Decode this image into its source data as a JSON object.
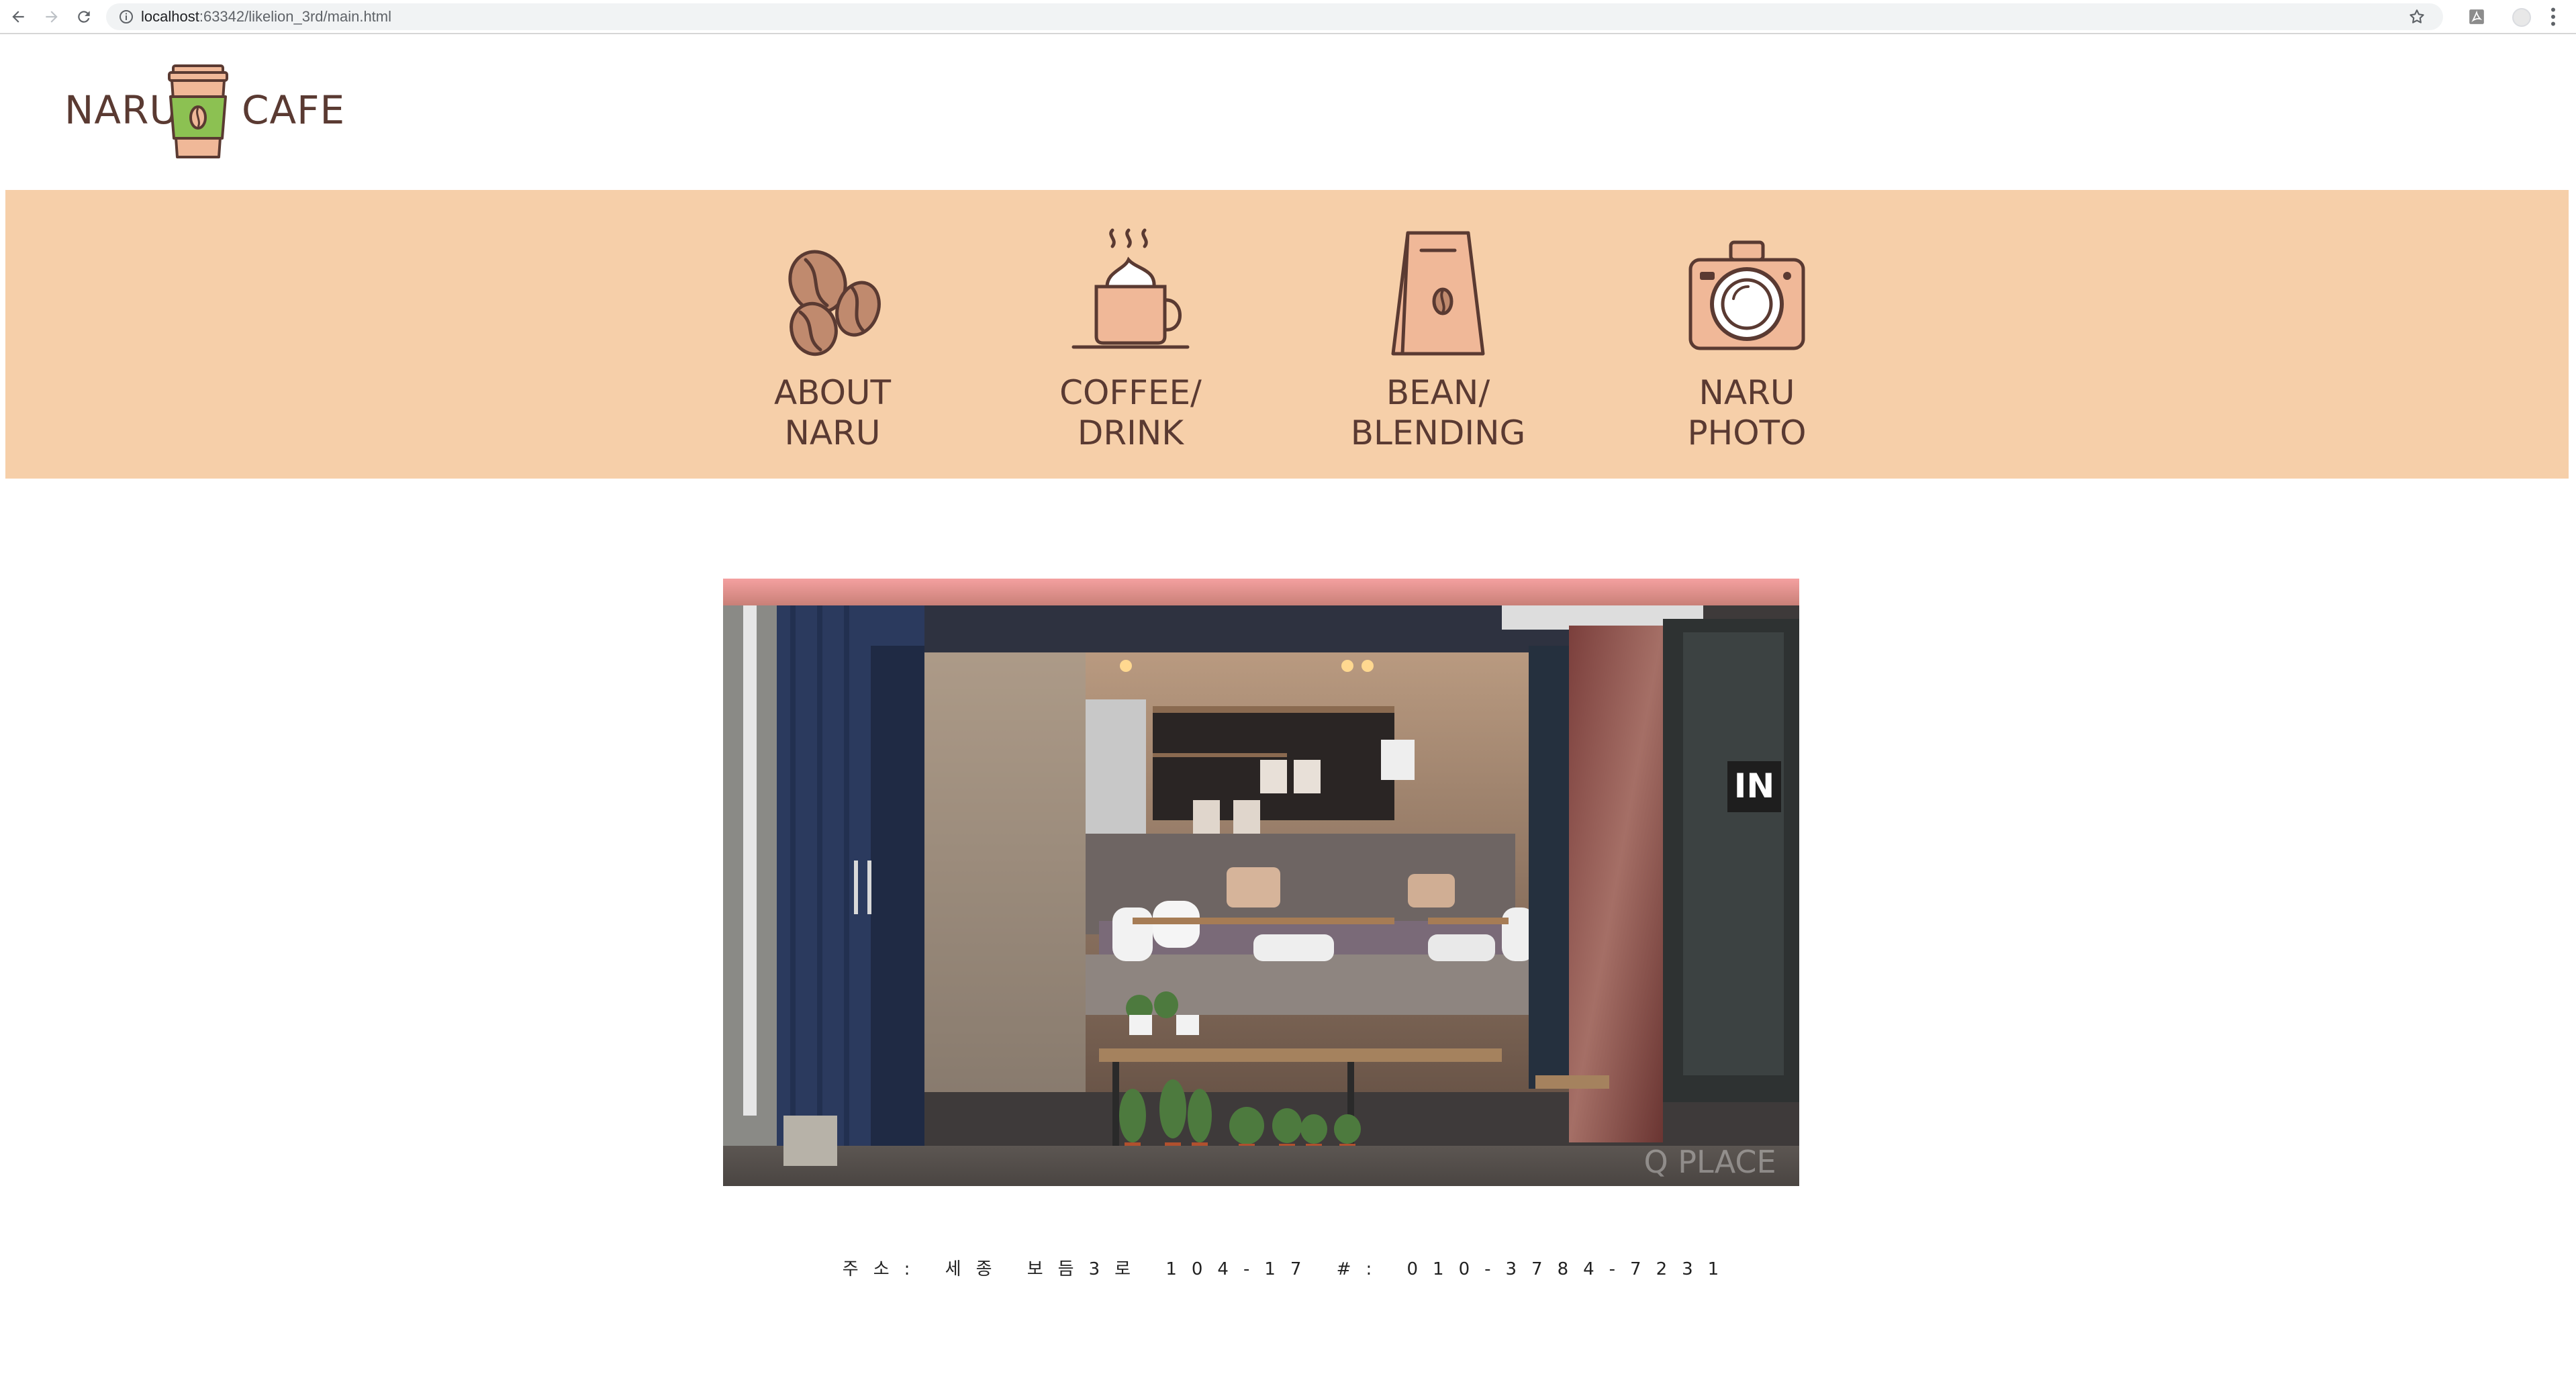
{
  "browser": {
    "url_host": "localhost",
    "url_rest": ":63342/likelion_3rd/main.html"
  },
  "logo": {
    "left_word": "NARU",
    "right_word": "CAFE"
  },
  "nav": {
    "items": [
      {
        "line1": "ABOUT",
        "line2": "NARU",
        "icon": "coffee-beans-icon"
      },
      {
        "line1": "COFFEE/",
        "line2": "DRINK",
        "icon": "coffee-cup-icon"
      },
      {
        "line1": "BEAN/",
        "line2": "BLENDING",
        "icon": "coffee-bag-icon"
      },
      {
        "line1": "NARU",
        "line2": "PHOTO",
        "icon": "camera-icon"
      }
    ]
  },
  "photo": {
    "sign_text": "IN",
    "watermark": "Q PLACE"
  },
  "footer": {
    "text": "주소: 세종 보듬3로 104-17 #: 010-3784-7231"
  },
  "colors": {
    "nav_band": "#f6cfa9",
    "brand_brown": "#5a3a32",
    "cup_green": "#8cc152",
    "cup_peach": "#f0b898"
  }
}
